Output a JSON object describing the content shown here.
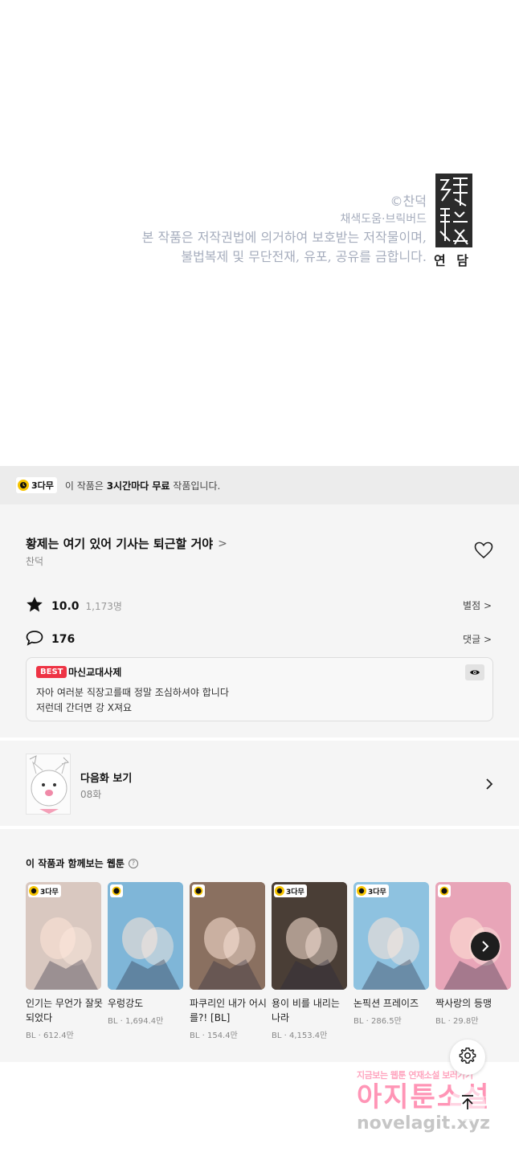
{
  "credits": {
    "copyright": "©찬덕",
    "studio": "채색도움·브릭버드",
    "notice_line1": "본 작품은 저작권법에 의거하여 보호받는 저작물이며,",
    "notice_line2": "불법복제 및 무단전재, 유포, 공유를 금합니다.",
    "seal_label": "연 담"
  },
  "banner": {
    "badge": "3다무",
    "text_prefix": "이 작품은 ",
    "text_bold": "3시간마다 무료",
    "text_suffix": " 작품입니다."
  },
  "work": {
    "title": "황제는 여기 있어 기사는 퇴근할 거야",
    "title_chevron": ">",
    "author": "찬덕",
    "rating": "10.0",
    "rating_count": "1,173명",
    "rating_link": "별점 >",
    "comment_count": "176",
    "comment_link": "댓글 >"
  },
  "best_comment": {
    "badge": "BEST",
    "user": "마신교대사제",
    "line1": "자아 여러분 직장고를때 정말 조심하셔야 합니다",
    "line2": "저런데 간더면 강 X져요"
  },
  "next_episode": {
    "title": "다음화 보기",
    "episode": "08화"
  },
  "recommendations": {
    "heading": "이 작품과 함께보는 웹툰",
    "help": "?",
    "items": [
      {
        "title": "인기는 무언가 잘못되었다",
        "meta": "BL · 612.4만",
        "badge": "3다무",
        "bg": "#d9c8c0"
      },
      {
        "title": "우렁강도",
        "meta": "BL · 1,694.4만",
        "badge": "",
        "bg": "#7fb6d8"
      },
      {
        "title": "파쿠리인 내가 어시를?! [BL]",
        "meta": "BL · 154.4만",
        "badge": "",
        "bg": "#8a7060"
      },
      {
        "title": "용이 비를 내리는 나라",
        "meta": "BL · 4,153.4만",
        "badge": "3다무",
        "bg": "#4a3e36"
      },
      {
        "title": "논픽션 프레이즈",
        "meta": "BL · 286.5만",
        "badge": "3다무",
        "bg": "#8ec2e0"
      },
      {
        "title": "짝사랑의 등맹",
        "meta": "BL · 29.8만",
        "badge": "",
        "bg": "#e8a5b8"
      }
    ]
  },
  "watermark": {
    "line1": "지금보는 웹툰 연재소설 보러가기",
    "line2": "아지툰소설",
    "line3": "novelagit.xyz"
  },
  "colors": {
    "accent_yellow": "#f6c400",
    "best_red": "#ee3344",
    "panel_bg": "#f5f5f5"
  },
  "icons": [
    "clock-icon",
    "star-icon",
    "comment-icon",
    "heart-icon",
    "eye-icon",
    "chevron-right-icon",
    "gear-icon",
    "arrow-up-icon",
    "help-icon"
  ]
}
